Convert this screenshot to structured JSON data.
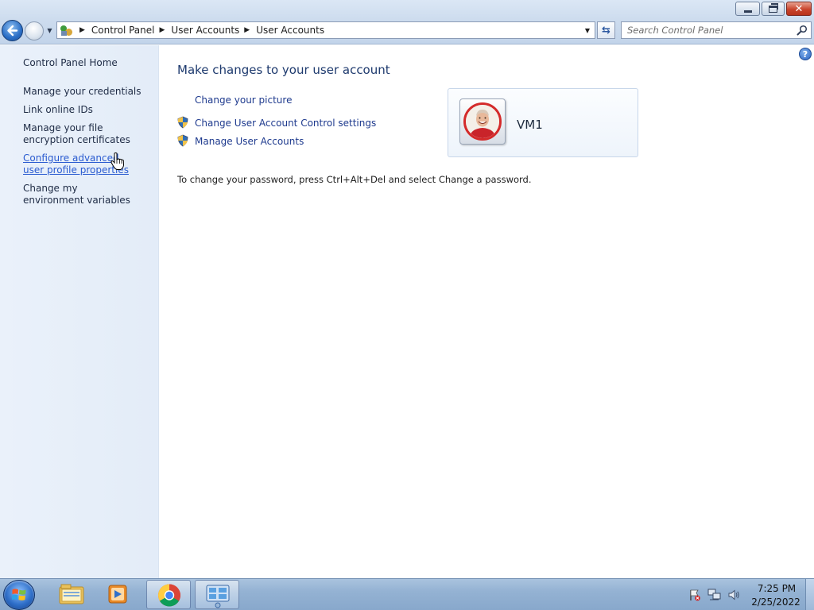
{
  "window": {
    "minimize_icon": "minimize-icon",
    "maximize_icon": "restore-icon",
    "close_icon": "close-icon"
  },
  "nav": {
    "back_icon": "back-arrow-icon",
    "forward_icon": "forward-arrow-icon",
    "breadcrumbs": [
      "Control Panel",
      "User Accounts",
      "User Accounts"
    ],
    "search_placeholder": "Search Control Panel"
  },
  "sidebar": {
    "items": [
      {
        "label": "Control Panel Home"
      },
      {
        "label": "Manage your credentials"
      },
      {
        "label": "Link online IDs"
      },
      {
        "label": "Manage your file encryption certificates"
      },
      {
        "label": "Configure advanced user profile properties"
      },
      {
        "label": "Change my environment variables"
      }
    ]
  },
  "main": {
    "title": "Make changes to your user account",
    "tasks": [
      {
        "label": "Change your picture",
        "icon": "none"
      },
      {
        "label": "Change User Account Control settings",
        "icon": "uac-shield-icon"
      },
      {
        "label": "Manage User Accounts",
        "icon": "uac-shield-icon"
      }
    ],
    "password_note": "To change your password, press Ctrl+Alt+Del and select Change a password.",
    "account": {
      "name": "VM1"
    }
  },
  "taskbar": {
    "pinned": [
      "windows-explorer-icon",
      "media-player-icon",
      "chrome-icon",
      "control-panel-icon"
    ],
    "clock": {
      "time": "7:25 PM",
      "date": "2/25/2022"
    }
  },
  "colors": {
    "link": "#1e3a8e",
    "title": "#1e3a6e",
    "sidebar_bg": "#e3ecf8",
    "taskbar_bg": "#94b2d3"
  }
}
